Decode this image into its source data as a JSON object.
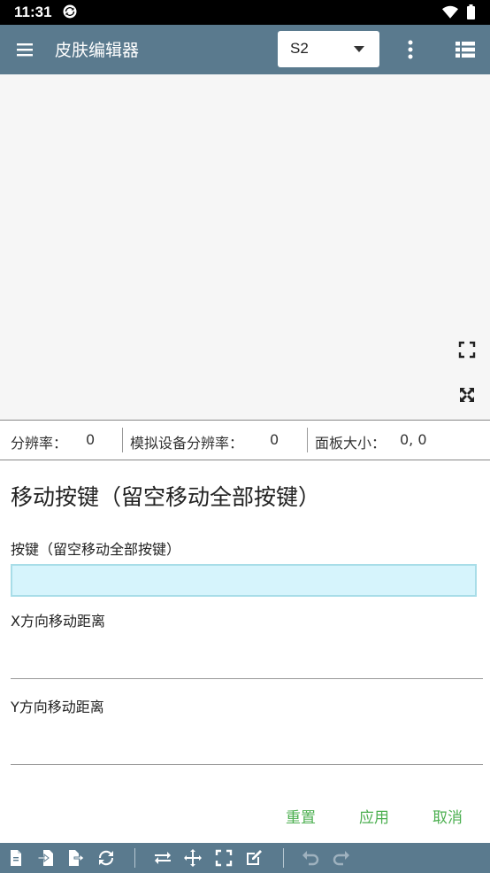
{
  "status_bar": {
    "time": "11:31"
  },
  "app_bar": {
    "title": "皮肤编辑器",
    "dropdown_value": "S2"
  },
  "info_bar": {
    "resolution_label": "分辨率：",
    "resolution_value": "0",
    "sim_resolution_label": "模拟设备分辨率：",
    "sim_resolution_value": "0",
    "panel_size_label": "面板大小：",
    "panel_size_value": "0, 0"
  },
  "form": {
    "title": "移动按键（留空移动全部按键）",
    "key_label": "按键（留空移动全部按键）",
    "key_value": "",
    "x_label": "X方向移动距离",
    "x_value": "",
    "y_label": "Y方向移动距离",
    "y_value": "",
    "reset_label": "重置",
    "apply_label": "应用",
    "cancel_label": "取消"
  },
  "colors": {
    "app_bar": "#5a7a8e",
    "accent_green": "#4caf50",
    "input_highlight": "#d6f4fc"
  },
  "toolbar_icons": [
    "new-file-icon",
    "import-icon",
    "export-icon",
    "refresh-icon",
    "swap-icon",
    "move-icon",
    "fullscreen-icon",
    "edit-icon",
    "undo-icon",
    "redo-icon"
  ]
}
